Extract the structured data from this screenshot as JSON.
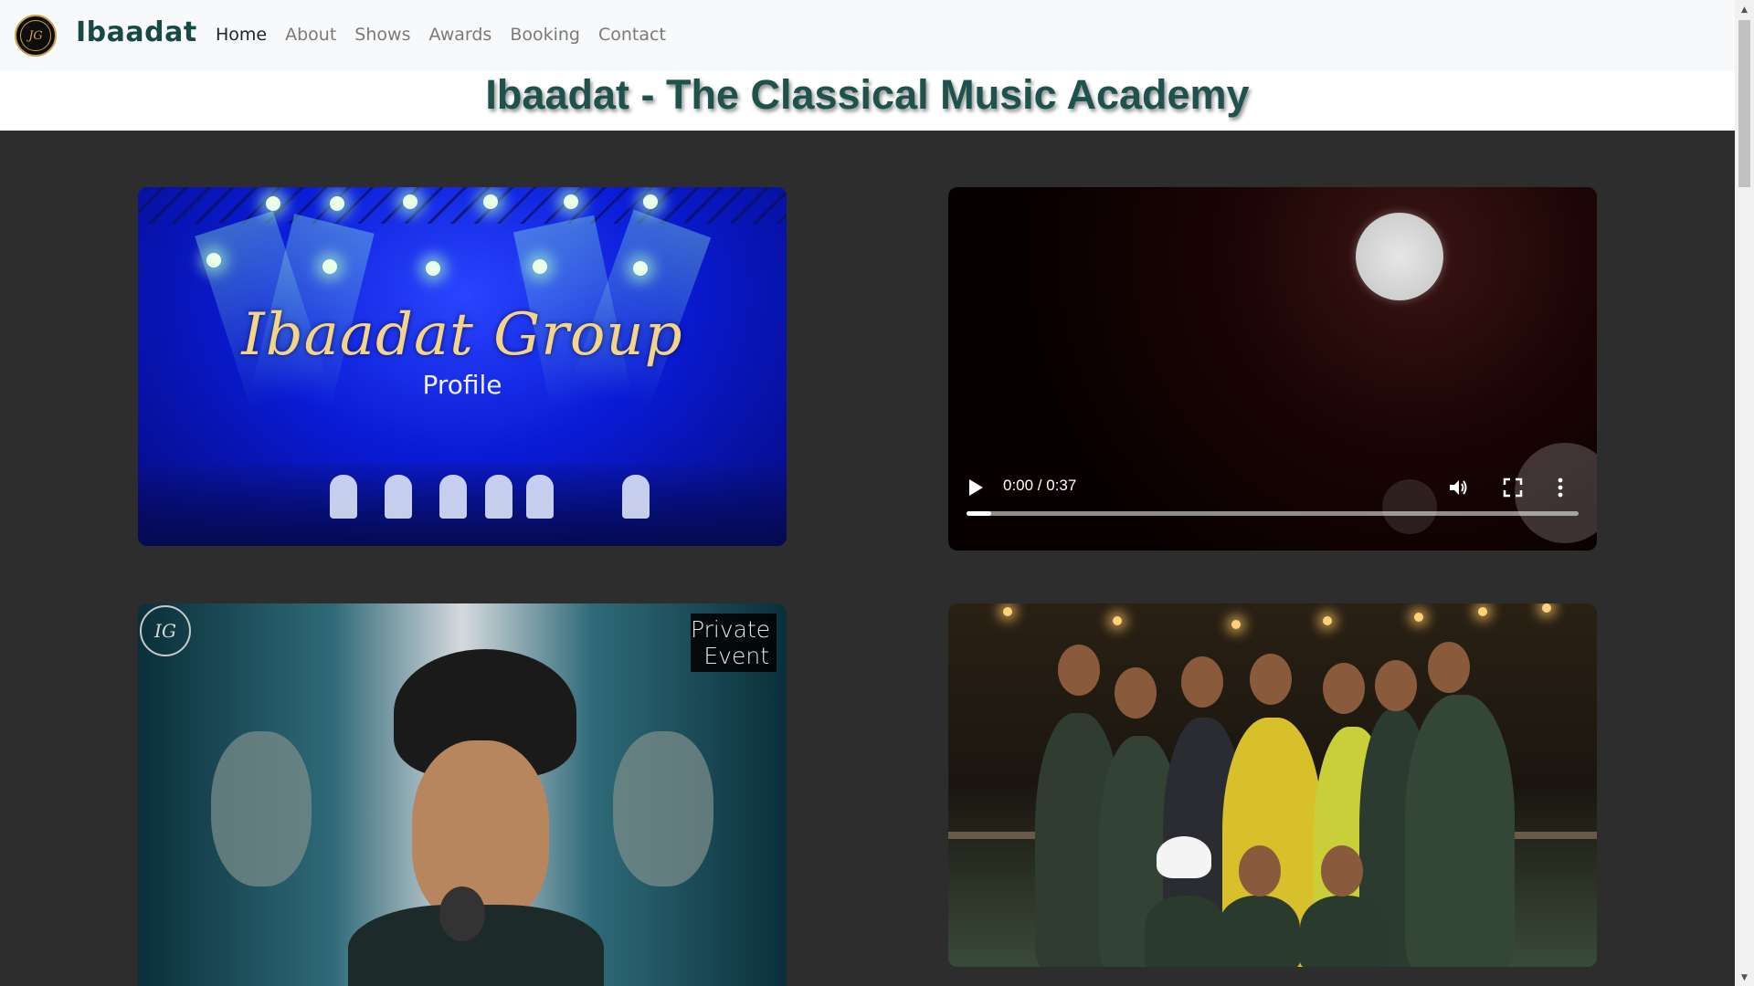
{
  "navbar": {
    "brand_name": "Ibaadat",
    "logo_text": "JG",
    "links": [
      {
        "label": "Home",
        "active": true
      },
      {
        "label": "About",
        "active": false
      },
      {
        "label": "Shows",
        "active": false
      },
      {
        "label": "Awards",
        "active": false
      },
      {
        "label": "Booking",
        "active": false
      },
      {
        "label": "Contact",
        "active": false
      }
    ]
  },
  "page": {
    "title": "Ibaadat - The Classical Music Academy"
  },
  "gallery": {
    "profile_card": {
      "title": "Ibaadat Group",
      "subtitle": "Profile"
    },
    "video_card": {
      "time_display": "0:00 / 0:37",
      "progress_fraction": 0.04
    },
    "event_card": {
      "logo_text": "IG",
      "tag_line1": "Private",
      "tag_line2": "Event"
    },
    "group_photo_card": {}
  },
  "icons": {
    "play": "play-icon",
    "volume": "volume-icon",
    "fullscreen": "fullscreen-icon",
    "more": "more-vertical-icon"
  },
  "colors": {
    "brand": "#174a45",
    "title": "#1f524c",
    "navbar_bg": "#f8f9fa",
    "page_bg": "#2d2d2d"
  }
}
